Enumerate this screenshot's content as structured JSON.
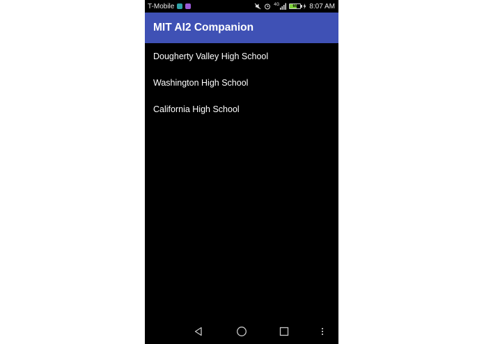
{
  "colors": {
    "app_bar": "#3f51b5",
    "background": "#000000",
    "status_text": "#e8e8e8",
    "battery_fill": "#7ed23a",
    "notif_1": "#2fa3a8",
    "notif_2": "#9a5bd6"
  },
  "status_bar": {
    "carrier": "T-Mobile",
    "network": "4G",
    "time": "8:07 AM",
    "battery_level": "65",
    "battery_fraction": 0.65,
    "icons": [
      "notification-teal-icon",
      "notification-purple-icon",
      "mute-icon",
      "alarm-icon",
      "signal-icon",
      "battery-icon"
    ]
  },
  "app_bar": {
    "title": "MIT AI2 Companion"
  },
  "list": {
    "items": [
      {
        "label": "Dougherty Valley High School"
      },
      {
        "label": "Washington High School"
      },
      {
        "label": "California High School"
      }
    ]
  },
  "nav_bar": {
    "icons": [
      "back-icon",
      "home-icon",
      "recents-icon",
      "overflow-menu-icon"
    ]
  }
}
